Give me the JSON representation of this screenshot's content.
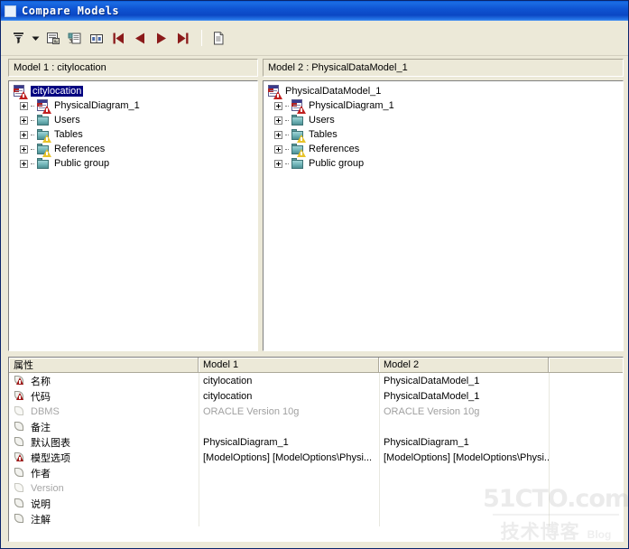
{
  "window": {
    "title": "Compare Models",
    "icon": "window-app-icon"
  },
  "toolbar": {
    "buttons": [
      {
        "name": "filter-icon",
        "glyph": "filter"
      },
      {
        "name": "filter-dropdown-arrow-icon",
        "glyph": "caret-down"
      },
      {
        "name": "properties-icon",
        "glyph": "properties"
      },
      {
        "name": "compare-options-icon",
        "glyph": "compare-options"
      },
      {
        "name": "side-by-side-icon",
        "glyph": "side-by-side"
      },
      {
        "name": "first-difference-icon",
        "glyph": "first"
      },
      {
        "name": "previous-difference-icon",
        "glyph": "prev"
      },
      {
        "name": "next-difference-icon",
        "glyph": "next"
      },
      {
        "name": "last-difference-icon",
        "glyph": "last"
      },
      {
        "name": "toolbar-separator",
        "glyph": "separator"
      },
      {
        "name": "report-icon",
        "glyph": "document"
      }
    ]
  },
  "panels": {
    "left": {
      "header": "Model 1 : citylocation",
      "tree": [
        {
          "label": "citylocation",
          "icon": "model-icon",
          "level": 0,
          "expandable": false,
          "selected": true
        },
        {
          "label": "PhysicalDiagram_1",
          "icon": "diagram-icon",
          "level": 1,
          "expandable": true,
          "selected": false
        },
        {
          "label": "Users",
          "icon": "folder-icon",
          "level": 1,
          "expandable": true,
          "selected": false
        },
        {
          "label": "Tables",
          "icon": "folder-warning-icon",
          "level": 1,
          "expandable": true,
          "selected": false
        },
        {
          "label": "References",
          "icon": "folder-warning-icon",
          "level": 1,
          "expandable": true,
          "selected": false
        },
        {
          "label": "Public group",
          "icon": "folder-icon",
          "level": 1,
          "expandable": true,
          "selected": false
        }
      ]
    },
    "right": {
      "header": "Model 2 : PhysicalDataModel_1",
      "tree": [
        {
          "label": "PhysicalDataModel_1",
          "icon": "model-icon",
          "level": 0,
          "expandable": false,
          "selected": false
        },
        {
          "label": "PhysicalDiagram_1",
          "icon": "diagram-icon",
          "level": 1,
          "expandable": true,
          "selected": false
        },
        {
          "label": "Users",
          "icon": "folder-icon",
          "level": 1,
          "expandable": true,
          "selected": false
        },
        {
          "label": "Tables",
          "icon": "folder-warning-icon",
          "level": 1,
          "expandable": true,
          "selected": false
        },
        {
          "label": "References",
          "icon": "folder-warning-icon",
          "level": 1,
          "expandable": true,
          "selected": false
        },
        {
          "label": "Public group",
          "icon": "folder-icon",
          "level": 1,
          "expandable": true,
          "selected": false
        }
      ]
    }
  },
  "properties_grid": {
    "columns": [
      "属性",
      "Model 1",
      "Model 2",
      ""
    ],
    "rows": [
      {
        "property": "名称",
        "icon": "property-warning-icon",
        "dim": false,
        "model1": "citylocation",
        "model2": "PhysicalDataModel_1"
      },
      {
        "property": "代码",
        "icon": "property-warning-icon",
        "dim": false,
        "model1": "citylocation",
        "model2": "PhysicalDataModel_1"
      },
      {
        "property": "DBMS",
        "icon": "property-icon",
        "dim": true,
        "model1": "ORACLE Version 10g",
        "model2": "ORACLE Version 10g"
      },
      {
        "property": "备注",
        "icon": "property-icon",
        "dim": false,
        "model1": "",
        "model2": ""
      },
      {
        "property": "默认图表",
        "icon": "property-icon",
        "dim": false,
        "model1": "PhysicalDiagram_1",
        "model2": "PhysicalDiagram_1"
      },
      {
        "property": "模型选项",
        "icon": "property-warning-icon",
        "dim": false,
        "model1": "[ModelOptions]  [ModelOptions\\Physi...",
        "model2": "[ModelOptions]  [ModelOptions\\Physi..."
      },
      {
        "property": "作者",
        "icon": "property-icon",
        "dim": false,
        "model1": "",
        "model2": ""
      },
      {
        "property": "Version",
        "icon": "property-icon",
        "dim": true,
        "model1": "",
        "model2": ""
      },
      {
        "property": "说明",
        "icon": "property-icon",
        "dim": false,
        "model1": "",
        "model2": ""
      },
      {
        "property": "注解",
        "icon": "property-icon",
        "dim": false,
        "model1": "",
        "model2": ""
      }
    ]
  },
  "watermark": {
    "site": "51CTO.com",
    "cn": "技术博客",
    "blog": "Blog"
  },
  "colors": {
    "titlebar": "#0b47c4",
    "chrome": "#ece9d8",
    "selection": "#000080",
    "warning_red": "#c02020",
    "warning_yellow": "#e8c32a",
    "nav_arrow": "#8b1a1a"
  }
}
